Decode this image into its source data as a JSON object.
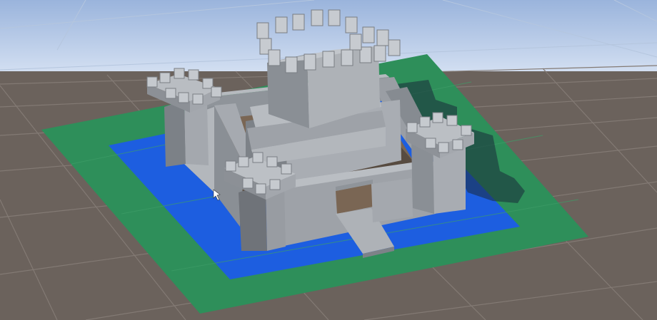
{
  "scene": {
    "view": "perspective",
    "subject": "castle",
    "parts": [
      "ground-grid",
      "grass-base",
      "moat-water",
      "curtain-walls",
      "courtyard",
      "corner-towers",
      "central-keep",
      "gate-arch",
      "drawbridge"
    ]
  },
  "colors": {
    "sky_top": "#9ab4dc",
    "sky_horizon": "#cfdcf0",
    "ground": "#6b625c",
    "grid_line": "#837a74",
    "grass": "#2e8f5a",
    "water": "#1d5ee0",
    "stone_light": "#aaaeb4",
    "stone_mid": "#8f949a",
    "stone_dark": "#6f7379",
    "courtyard_floor": "#7a6654",
    "shadow": "#2a2a2a"
  }
}
